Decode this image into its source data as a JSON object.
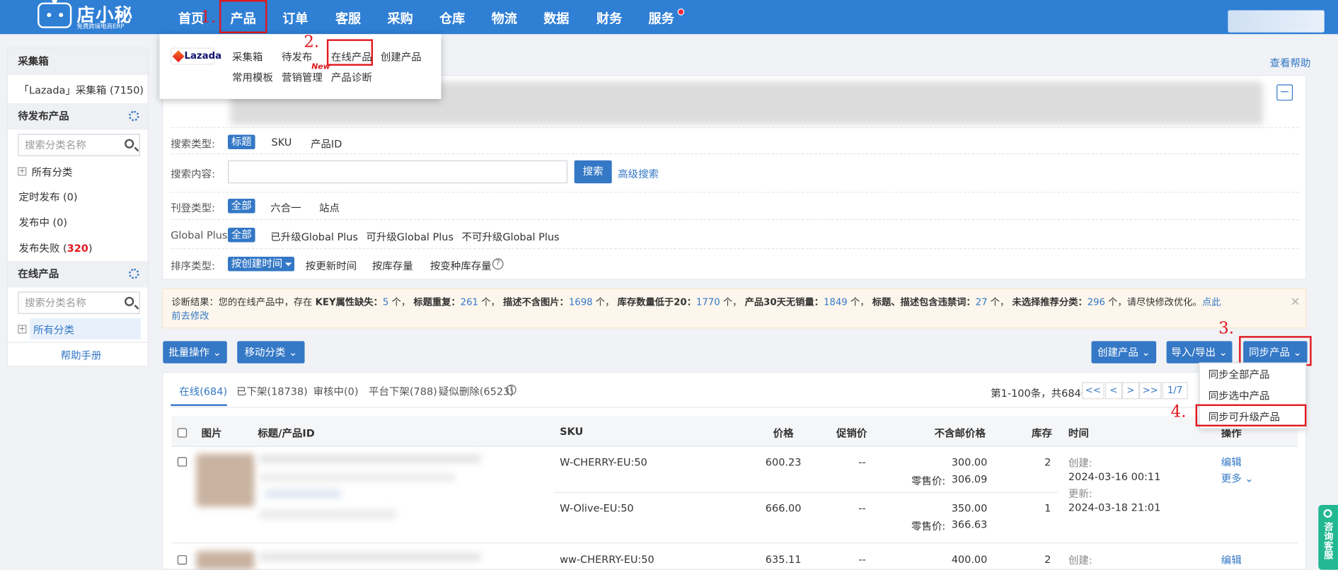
{
  "logo": {
    "name": "店小秘",
    "subtitle": "免费跨境电商ERP"
  },
  "nav": {
    "home": "首页",
    "product": "产品",
    "orders": "订单",
    "service": "客服",
    "purchase": "采购",
    "warehouse": "仓库",
    "logistics": "物流",
    "data": "数据",
    "finance": "财务",
    "services": "服务"
  },
  "steps": {
    "s1": "1.",
    "s2": "2.",
    "s3": "3.",
    "s4": "4."
  },
  "product_menu": {
    "brand": "Lazada",
    "row1": [
      "采集箱",
      "待发布",
      "在线产品",
      "创建产品"
    ],
    "row2": [
      "常用模板",
      "营销管理",
      "产品诊断"
    ],
    "new_badge": "New"
  },
  "help_link": "查看帮助",
  "sidebar": {
    "collect_title": "采集箱",
    "collect_item": "「Lazada」采集箱 (7150)",
    "pending_title": "待发布产品",
    "search_placeholder": "搜索分类名称",
    "all_categories": "所有分类",
    "scheduled": "定时发布 (0)",
    "publishing": "发布中 (0)",
    "failed_label": "发布失败 (",
    "failed_count": "320",
    "failed_end": ")",
    "online_title": "在线产品",
    "online_search_placeholder": "搜索分类名称",
    "online_all_categories": "所有分类",
    "manual": "帮助手册"
  },
  "filters": {
    "search_type_label": "搜索类型:",
    "search_types": [
      "标题",
      "SKU",
      "产品ID"
    ],
    "content_label": "搜索内容:",
    "search_button": "搜索",
    "advanced": "高级搜索",
    "listing_type_label": "刊登类型:",
    "listing_types": [
      "全部",
      "六合一",
      "站点"
    ],
    "global_plus_label": "Global Plus:",
    "global_plus_opts": [
      "全部",
      "已升级Global Plus",
      "可升级Global Plus",
      "不可升级Global Plus"
    ],
    "sort_label": "排序类型:",
    "sort_opts": [
      "按创建时间",
      "按更新时间",
      "按库存量",
      "按变种库存量"
    ]
  },
  "notice": {
    "prefix": "诊断结果：您的在线产品中，存在",
    "k1": "KEY属性缺失：",
    "v1": "5",
    "k2": "标题重复：",
    "v2": "261",
    "k3": "描述不含图片：",
    "v3": "1698",
    "k4": "库存数量低于20：",
    "v4": "1770",
    "k5": "产品30天无销量：",
    "v5": "1849",
    "k6": "标题、描述包含违禁词：",
    "v6": "27",
    "k7": "未选择推荐分类：",
    "v7": "296",
    "unit": "个，",
    "suffix": "个，请尽快修改优化。",
    "link": "点此前去修改",
    "link_a": "点此",
    "link_b": "前去修改",
    "close": "×"
  },
  "actions": {
    "bulk": "批量操作",
    "move": "移动分类",
    "create": "创建产品",
    "import_export": "导入/导出",
    "sync": "同步产品"
  },
  "sync_menu": [
    "同步全部产品",
    "同步选中产品",
    "同步可升级产品"
  ],
  "tabs": [
    "在线(684)",
    "已下架(18738)",
    "审核中(0)",
    "平台下架(788)",
    "疑似删除(6523)"
  ],
  "pagination": {
    "info": "第1-100条，共684条",
    "first": "<<",
    "prev": "<",
    "next": ">",
    "last": ">>",
    "page": "1/7"
  },
  "table": {
    "headers": {
      "image": "图片",
      "title": "标题/产品ID",
      "sku": "SKU",
      "price": "价格",
      "promo": "促销价",
      "excl": "不含邮价格",
      "stock": "库存",
      "time": "时间",
      "op": "操作"
    },
    "rows": [
      {
        "sku": "W-CHERRY-EU:50",
        "price": "600.23",
        "promo": "--",
        "excl": "300.00",
        "retail_label": "零售价:",
        "retail": "306.09",
        "stock": "2"
      },
      {
        "sku": "W-Olive-EU:50",
        "price": "666.00",
        "promo": "--",
        "excl": "350.00",
        "retail_label": "零售价:",
        "retail": "366.63",
        "stock": "1"
      },
      {
        "sku": "ww-CHERRY-EU:50",
        "price": "635.11",
        "promo": "--",
        "excl": "400.00",
        "stock": "2"
      }
    ],
    "time": {
      "created_label": "创建:",
      "created": "2024-03-16 00:11",
      "updated_label": "更新:",
      "updated": "2024-03-18 21:01",
      "created_label2": "创建:"
    },
    "ops": {
      "edit": "编辑",
      "more": "更多",
      "edit2": "编辑"
    }
  },
  "consult": "咨询客服",
  "colors": {
    "primary": "#3478c6",
    "topbar": "#2f7fd5",
    "highlight": "#e0191f",
    "consult": "#21b892"
  }
}
